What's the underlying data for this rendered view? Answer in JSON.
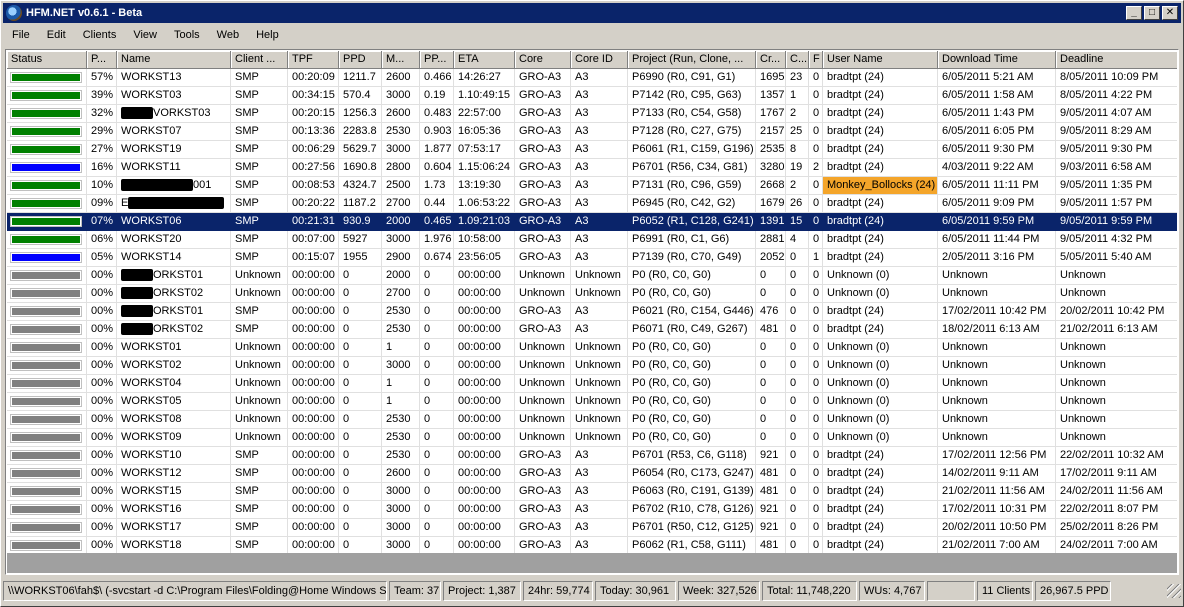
{
  "window": {
    "title": "HFM.NET v0.6.1 - Beta",
    "minimize": "_",
    "maximize": "□",
    "close": "✕"
  },
  "menu": [
    "File",
    "Edit",
    "Clients",
    "View",
    "Tools",
    "Web",
    "Help"
  ],
  "columns": [
    "Status",
    "P...",
    "Name",
    "Client ...",
    "TPF",
    "PPD",
    "M...",
    "PP...",
    "ETA",
    "Core",
    "Core ID",
    "Project (Run, Clone, ...",
    "Cr...",
    "C...",
    "F",
    "User Name",
    "Download Time",
    "Deadline"
  ],
  "status_colors": {
    "green": "#008000",
    "blue": "#0000ff",
    "gray": "#808080"
  },
  "rows": [
    {
      "status": "green",
      "progress": "57%",
      "name": "WORKST13",
      "client": "SMP",
      "tpf": "00:20:09",
      "ppd": "1211.7",
      "mem": "2600",
      "pp": "0.466",
      "eta": "14:26:27",
      "core": "GRO-A3",
      "core_id": "A3",
      "project": "P6990 (R0, C91, G1)",
      "credit": "1695",
      "c": "23",
      "f": "0",
      "user": "bradtpt (24)",
      "download": "6/05/2011 5:21 AM",
      "deadline": "8/05/2011 10:09 PM"
    },
    {
      "status": "green",
      "progress": "39%",
      "name": "WORKST03",
      "client": "SMP",
      "tpf": "00:34:15",
      "ppd": "570.4",
      "mem": "3000",
      "pp": "0.19",
      "eta": "1.10:49:15",
      "core": "GRO-A3",
      "core_id": "A3",
      "project": "P7142 (R0, C95, G63)",
      "credit": "1357",
      "c": "1",
      "f": "0",
      "user": "bradtpt (24)",
      "download": "6/05/2011 1:58 AM",
      "deadline": "8/05/2011 4:22 PM"
    },
    {
      "status": "green",
      "progress": "32%",
      "name": "VORKST03",
      "redact": "pre",
      "client": "SMP",
      "tpf": "00:20:15",
      "ppd": "1256.3",
      "mem": "2600",
      "pp": "0.483",
      "eta": "22:57:00",
      "core": "GRO-A3",
      "core_id": "A3",
      "project": "P7133 (R0, C54, G58)",
      "credit": "1767",
      "c": "2",
      "f": "0",
      "user": "bradtpt (24)",
      "download": "6/05/2011 1:43 PM",
      "deadline": "9/05/2011 4:07 AM"
    },
    {
      "status": "green",
      "progress": "29%",
      "name": "WORKST07",
      "client": "SMP",
      "tpf": "00:13:36",
      "ppd": "2283.8",
      "mem": "2530",
      "pp": "0.903",
      "eta": "16:05:36",
      "core": "GRO-A3",
      "core_id": "A3",
      "project": "P7128 (R0, C27, G75)",
      "credit": "2157",
      "c": "25",
      "f": "0",
      "user": "bradtpt (24)",
      "download": "6/05/2011 6:05 PM",
      "deadline": "9/05/2011 8:29 AM"
    },
    {
      "status": "green",
      "progress": "27%",
      "name": "WORKST19",
      "client": "SMP",
      "tpf": "00:06:29",
      "ppd": "5629.7",
      "mem": "3000",
      "pp": "1.877",
      "eta": "07:53:17",
      "core": "GRO-A3",
      "core_id": "A3",
      "project": "P6061 (R1, C159, G196)",
      "credit": "2535",
      "c": "8",
      "f": "0",
      "user": "bradtpt (24)",
      "download": "6/05/2011 9:30 PM",
      "deadline": "9/05/2011 9:30 PM"
    },
    {
      "status": "blue",
      "progress": "16%",
      "name": "WORKST11",
      "client": "SMP",
      "tpf": "00:27:56",
      "ppd": "1690.8",
      "mem": "2800",
      "pp": "0.604",
      "eta": "1.15:06:24",
      "core": "GRO-A3",
      "core_id": "A3",
      "project": "P6701 (R56, C34, G81)",
      "credit": "3280",
      "c": "19",
      "f": "2",
      "user": "bradtpt (24)",
      "download": "4/03/2011 9:22 AM",
      "deadline": "9/03/2011 6:58 AM"
    },
    {
      "status": "green",
      "progress": "10%",
      "name": "001",
      "redact": "long",
      "client": "SMP",
      "tpf": "00:08:53",
      "ppd": "4324.7",
      "mem": "2500",
      "pp": "1.73",
      "eta": "13:19:30",
      "core": "GRO-A3",
      "core_id": "A3",
      "project": "P7131 (R0, C96, G59)",
      "credit": "2668",
      "c": "2",
      "f": "0",
      "user": "Monkey_Bollocks (24)",
      "user_highlight": true,
      "download": "6/05/2011 11:11 PM",
      "deadline": "9/05/2011 1:35 PM"
    },
    {
      "status": "green",
      "progress": "09%",
      "name": "E",
      "redact": "post",
      "client": "SMP",
      "tpf": "00:20:22",
      "ppd": "1187.2",
      "mem": "2700",
      "pp": "0.44",
      "eta": "1.06:53:22",
      "core": "GRO-A3",
      "core_id": "A3",
      "project": "P6945 (R0, C42, G2)",
      "credit": "1679",
      "c": "26",
      "f": "0",
      "user": "bradtpt (24)",
      "download": "6/05/2011 9:09 PM",
      "deadline": "9/05/2011 1:57 PM"
    },
    {
      "status": "green",
      "progress": "07%",
      "name": "WORKST06",
      "selected": true,
      "client": "SMP",
      "tpf": "00:21:31",
      "ppd": "930.9",
      "mem": "2000",
      "pp": "0.465",
      "eta": "1.09:21:03",
      "core": "GRO-A3",
      "core_id": "A3",
      "project": "P6052 (R1, C128, G241)",
      "credit": "1391",
      "c": "15",
      "f": "0",
      "user": "bradtpt (24)",
      "download": "6/05/2011 9:59 PM",
      "deadline": "9/05/2011 9:59 PM"
    },
    {
      "status": "green",
      "progress": "06%",
      "name": "WORKST20",
      "client": "SMP",
      "tpf": "00:07:00",
      "ppd": "5927",
      "mem": "3000",
      "pp": "1.976",
      "eta": "10:58:00",
      "core": "GRO-A3",
      "core_id": "A3",
      "project": "P6991 (R0, C1, G6)",
      "credit": "2881",
      "c": "4",
      "f": "0",
      "user": "bradtpt (24)",
      "download": "6/05/2011 11:44 PM",
      "deadline": "9/05/2011 4:32 PM"
    },
    {
      "status": "blue",
      "progress": "05%",
      "name": "WORKST14",
      "client": "SMP",
      "tpf": "00:15:07",
      "ppd": "1955",
      "mem": "2900",
      "pp": "0.674",
      "eta": "23:56:05",
      "core": "GRO-A3",
      "core_id": "A3",
      "project": "P7139 (R0, C70, G49)",
      "credit": "2052",
      "c": "0",
      "f": "1",
      "user": "bradtpt (24)",
      "download": "2/05/2011 3:16 PM",
      "deadline": "5/05/2011 5:40 AM"
    },
    {
      "status": "gray",
      "progress": "00%",
      "name": "ORKST01",
      "redact": "pre",
      "client": "Unknown",
      "tpf": "00:00:00",
      "ppd": "0",
      "mem": "2000",
      "pp": "0",
      "eta": "00:00:00",
      "core": "Unknown",
      "core_id": "Unknown",
      "project": "P0 (R0, C0, G0)",
      "credit": "0",
      "c": "0",
      "f": "0",
      "user": "Unknown (0)",
      "download": "Unknown",
      "deadline": "Unknown"
    },
    {
      "status": "gray",
      "progress": "00%",
      "name": "ORKST02",
      "redact": "pre",
      "client": "Unknown",
      "tpf": "00:00:00",
      "ppd": "0",
      "mem": "2700",
      "pp": "0",
      "eta": "00:00:00",
      "core": "Unknown",
      "core_id": "Unknown",
      "project": "P0 (R0, C0, G0)",
      "credit": "0",
      "c": "0",
      "f": "0",
      "user": "Unknown (0)",
      "download": "Unknown",
      "deadline": "Unknown"
    },
    {
      "status": "gray",
      "progress": "00%",
      "name": "ORKST01",
      "redact": "pre",
      "client": "SMP",
      "tpf": "00:00:00",
      "ppd": "0",
      "mem": "2530",
      "pp": "0",
      "eta": "00:00:00",
      "core": "GRO-A3",
      "core_id": "A3",
      "project": "P6021 (R0, C154, G446)",
      "credit": "476",
      "c": "0",
      "f": "0",
      "user": "bradtpt (24)",
      "download": "17/02/2011 10:42 PM",
      "deadline": "20/02/2011 10:42 PM"
    },
    {
      "status": "gray",
      "progress": "00%",
      "name": "ORKST02",
      "redact": "pre",
      "client": "SMP",
      "tpf": "00:00:00",
      "ppd": "0",
      "mem": "2530",
      "pp": "0",
      "eta": "00:00:00",
      "core": "GRO-A3",
      "core_id": "A3",
      "project": "P6071 (R0, C49, G267)",
      "credit": "481",
      "c": "0",
      "f": "0",
      "user": "bradtpt (24)",
      "download": "18/02/2011 6:13 AM",
      "deadline": "21/02/2011 6:13 AM"
    },
    {
      "status": "gray",
      "progress": "00%",
      "name": "WORKST01",
      "client": "Unknown",
      "tpf": "00:00:00",
      "ppd": "0",
      "mem": "1",
      "pp": "0",
      "eta": "00:00:00",
      "core": "Unknown",
      "core_id": "Unknown",
      "project": "P0 (R0, C0, G0)",
      "credit": "0",
      "c": "0",
      "f": "0",
      "user": "Unknown (0)",
      "download": "Unknown",
      "deadline": "Unknown"
    },
    {
      "status": "gray",
      "progress": "00%",
      "name": "WORKST02",
      "client": "Unknown",
      "tpf": "00:00:00",
      "ppd": "0",
      "mem": "3000",
      "pp": "0",
      "eta": "00:00:00",
      "core": "Unknown",
      "core_id": "Unknown",
      "project": "P0 (R0, C0, G0)",
      "credit": "0",
      "c": "0",
      "f": "0",
      "user": "Unknown (0)",
      "download": "Unknown",
      "deadline": "Unknown"
    },
    {
      "status": "gray",
      "progress": "00%",
      "name": "WORKST04",
      "client": "Unknown",
      "tpf": "00:00:00",
      "ppd": "0",
      "mem": "1",
      "pp": "0",
      "eta": "00:00:00",
      "core": "Unknown",
      "core_id": "Unknown",
      "project": "P0 (R0, C0, G0)",
      "credit": "0",
      "c": "0",
      "f": "0",
      "user": "Unknown (0)",
      "download": "Unknown",
      "deadline": "Unknown"
    },
    {
      "status": "gray",
      "progress": "00%",
      "name": "WORKST05",
      "client": "Unknown",
      "tpf": "00:00:00",
      "ppd": "0",
      "mem": "1",
      "pp": "0",
      "eta": "00:00:00",
      "core": "Unknown",
      "core_id": "Unknown",
      "project": "P0 (R0, C0, G0)",
      "credit": "0",
      "c": "0",
      "f": "0",
      "user": "Unknown (0)",
      "download": "Unknown",
      "deadline": "Unknown"
    },
    {
      "status": "gray",
      "progress": "00%",
      "name": "WORKST08",
      "client": "Unknown",
      "tpf": "00:00:00",
      "ppd": "0",
      "mem": "2530",
      "pp": "0",
      "eta": "00:00:00",
      "core": "Unknown",
      "core_id": "Unknown",
      "project": "P0 (R0, C0, G0)",
      "credit": "0",
      "c": "0",
      "f": "0",
      "user": "Unknown (0)",
      "download": "Unknown",
      "deadline": "Unknown"
    },
    {
      "status": "gray",
      "progress": "00%",
      "name": "WORKST09",
      "client": "Unknown",
      "tpf": "00:00:00",
      "ppd": "0",
      "mem": "2530",
      "pp": "0",
      "eta": "00:00:00",
      "core": "Unknown",
      "core_id": "Unknown",
      "project": "P0 (R0, C0, G0)",
      "credit": "0",
      "c": "0",
      "f": "0",
      "user": "Unknown (0)",
      "download": "Unknown",
      "deadline": "Unknown"
    },
    {
      "status": "gray",
      "progress": "00%",
      "name": "WORKST10",
      "client": "SMP",
      "tpf": "00:00:00",
      "ppd": "0",
      "mem": "2530",
      "pp": "0",
      "eta": "00:00:00",
      "core": "GRO-A3",
      "core_id": "A3",
      "project": "P6701 (R53, C6, G118)",
      "credit": "921",
      "c": "0",
      "f": "0",
      "user": "bradtpt (24)",
      "download": "17/02/2011 12:56 PM",
      "deadline": "22/02/2011 10:32 AM"
    },
    {
      "status": "gray",
      "progress": "00%",
      "name": "WORKST12",
      "client": "SMP",
      "tpf": "00:00:00",
      "ppd": "0",
      "mem": "2600",
      "pp": "0",
      "eta": "00:00:00",
      "core": "GRO-A3",
      "core_id": "A3",
      "project": "P6054 (R0, C173, G247)",
      "credit": "481",
      "c": "0",
      "f": "0",
      "user": "bradtpt (24)",
      "download": "14/02/2011 9:11 AM",
      "deadline": "17/02/2011 9:11 AM"
    },
    {
      "status": "gray",
      "progress": "00%",
      "name": "WORKST15",
      "client": "SMP",
      "tpf": "00:00:00",
      "ppd": "0",
      "mem": "3000",
      "pp": "0",
      "eta": "00:00:00",
      "core": "GRO-A3",
      "core_id": "A3",
      "project": "P6063 (R0, C191, G139)",
      "credit": "481",
      "c": "0",
      "f": "0",
      "user": "bradtpt (24)",
      "download": "21/02/2011 11:56 AM",
      "deadline": "24/02/2011 11:56 AM"
    },
    {
      "status": "gray",
      "progress": "00%",
      "name": "WORKST16",
      "client": "SMP",
      "tpf": "00:00:00",
      "ppd": "0",
      "mem": "3000",
      "pp": "0",
      "eta": "00:00:00",
      "core": "GRO-A3",
      "core_id": "A3",
      "project": "P6702 (R10, C78, G126)",
      "credit": "921",
      "c": "0",
      "f": "0",
      "user": "bradtpt (24)",
      "download": "17/02/2011 10:31 PM",
      "deadline": "22/02/2011 8:07 PM"
    },
    {
      "status": "gray",
      "progress": "00%",
      "name": "WORKST17",
      "client": "SMP",
      "tpf": "00:00:00",
      "ppd": "0",
      "mem": "3000",
      "pp": "0",
      "eta": "00:00:00",
      "core": "GRO-A3",
      "core_id": "A3",
      "project": "P6701 (R50, C12, G125)",
      "credit": "921",
      "c": "0",
      "f": "0",
      "user": "bradtpt (24)",
      "download": "20/02/2011 10:50 PM",
      "deadline": "25/02/2011 8:26 PM"
    },
    {
      "status": "gray",
      "progress": "00%",
      "name": "WORKST18",
      "client": "SMP",
      "tpf": "00:00:00",
      "ppd": "0",
      "mem": "3000",
      "pp": "0",
      "eta": "00:00:00",
      "core": "GRO-A3",
      "core_id": "A3",
      "project": "P6062 (R1, C58, G111)",
      "credit": "481",
      "c": "0",
      "f": "0",
      "user": "bradtpt (24)",
      "download": "21/02/2011 7:00 AM",
      "deadline": "24/02/2011 7:00 AM"
    }
  ],
  "statusbar": {
    "path": "\\\\WORKST06\\fah$\\ (-svcstart -d C:\\Program Files\\Folding@Home Windows SMP",
    "team": "Team: 37",
    "project": "Project: 1,387",
    "hr24": "24hr: 59,774",
    "today": "Today: 30,961",
    "week": "Week: 327,526",
    "total": "Total: 11,748,220",
    "wus": "WUs: 4,767",
    "blank": "",
    "clients": "11 Clients",
    "ppd": "26,967.5 PPD"
  }
}
